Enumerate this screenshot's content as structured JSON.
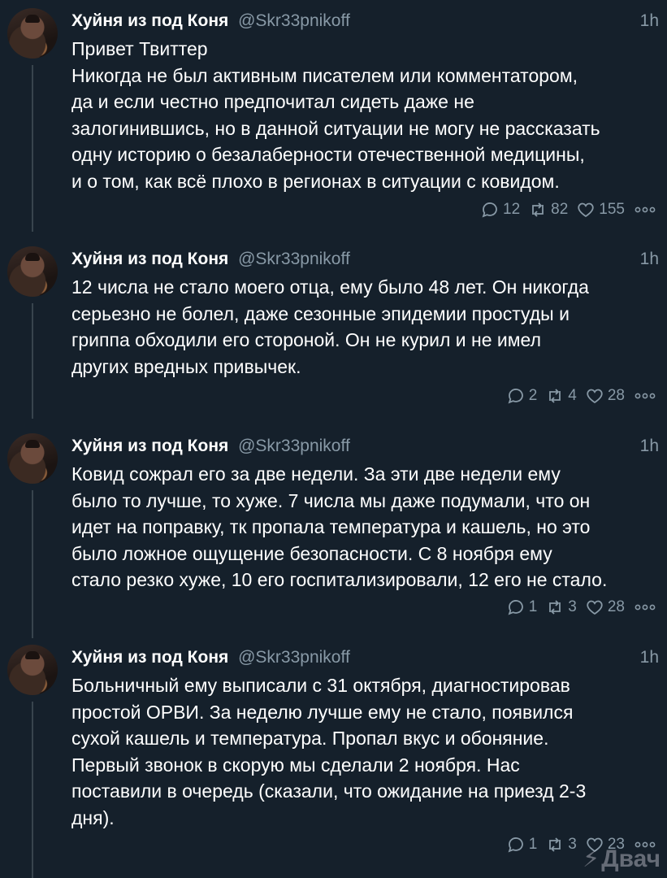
{
  "tweets": [
    {
      "name": "Хуйня из под Коня",
      "handle": "@Skr33pnikoff",
      "time": "1h",
      "text": "Привет Твиттер\nНикогда не был активным писателем или комментатором,\nда и если честно предпочитал сидеть даже не\nзалогинившись, но в данной ситуации не могу не рассказать\nодну историю о безалаберности отечественной медицины,\nи о том, как всё плохо в регионах в ситуации с ковидом.",
      "replies": "12",
      "retweets": "82",
      "likes": "155"
    },
    {
      "name": "Хуйня из под Коня",
      "handle": "@Skr33pnikoff",
      "time": "1h",
      "text": "12 числа не стало моего отца, ему было 48 лет. Он никогда\nсерьезно не болел, даже сезонные эпидемии простуды и\nгриппа обходили его стороной. Он не курил и не имел\nдругих вредных привычек.",
      "replies": "2",
      "retweets": "4",
      "likes": "28"
    },
    {
      "name": "Хуйня из под Коня",
      "handle": "@Skr33pnikoff",
      "time": "1h",
      "text": "Ковид сожрал его за две недели. За эти две недели ему\nбыло то лучше, то хуже. 7 числа мы даже подумали, что он\nидет на поправку, тк пропала температура и кашель, но это\nбыло ложное ощущение безопасности. С 8 ноября ему\nстало резко хуже, 10 его госпитализировали, 12 его не стало.",
      "replies": "1",
      "retweets": "3",
      "likes": "28"
    },
    {
      "name": "Хуйня из под Коня",
      "handle": "@Skr33pnikoff",
      "time": "1h",
      "text": "Больничный ему выписали с 31 октября, диагностировав\nпростой ОРВИ. За неделю лучше ему не стало, появился\nсухой кашель и температура. Пропал вкус и обоняние.\nПервый звонок в скорую мы сделали 2 ноября. Нас\nпоставили в очередь (сказали, что ожидание на приезд 2-3\nдня).",
      "replies": "1",
      "retweets": "3",
      "likes": "23"
    }
  ],
  "watermark": "Двач",
  "icons": [
    "reply-icon",
    "retweet-icon",
    "like-icon",
    "more-icon"
  ],
  "colors": {
    "background": "#15202b",
    "secondary_text": "#8899a6",
    "primary_text": "#ffffff"
  }
}
